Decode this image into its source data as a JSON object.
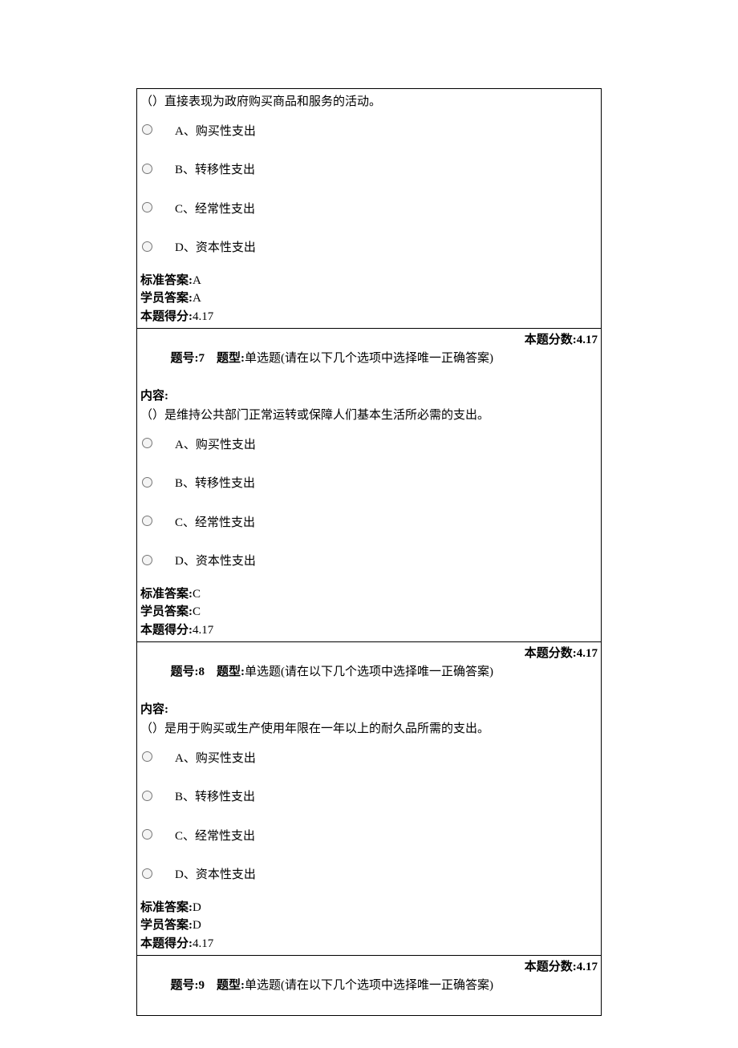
{
  "labels": {
    "question_no": "题号:",
    "question_type": "题型:",
    "question_score": "本题分数:",
    "content": "内容:",
    "standard_answer": "标准答案:",
    "student_answer": "学员答案:",
    "earned_score": "本题得分:"
  },
  "type_desc": "单选题(请在以下几个选项中选择唯一正确答案)",
  "q6": {
    "content": "（）直接表现为政府购买商品和服务的活动。",
    "opts": [
      "A、购买性支出",
      "B、转移性支出",
      "C、经常性支出",
      "D、资本性支出"
    ],
    "std": "A",
    "stu": "A",
    "earned": "4.17"
  },
  "q7": {
    "no": "7",
    "score": "4.17",
    "content": "（）是维持公共部门正常运转或保障人们基本生活所必需的支出。",
    "opts": [
      "A、购买性支出",
      "B、转移性支出",
      "C、经常性支出",
      "D、资本性支出"
    ],
    "std": "C",
    "stu": "C",
    "earned": "4.17"
  },
  "q8": {
    "no": "8",
    "score": "4.17",
    "content": "（）是用于购买或生产使用年限在一年以上的耐久品所需的支出。",
    "opts": [
      "A、购买性支出",
      "B、转移性支出",
      "C、经常性支出",
      "D、资本性支出"
    ],
    "std": "D",
    "stu": "D",
    "earned": "4.17"
  },
  "q9": {
    "no": "9",
    "score": "4.17"
  }
}
